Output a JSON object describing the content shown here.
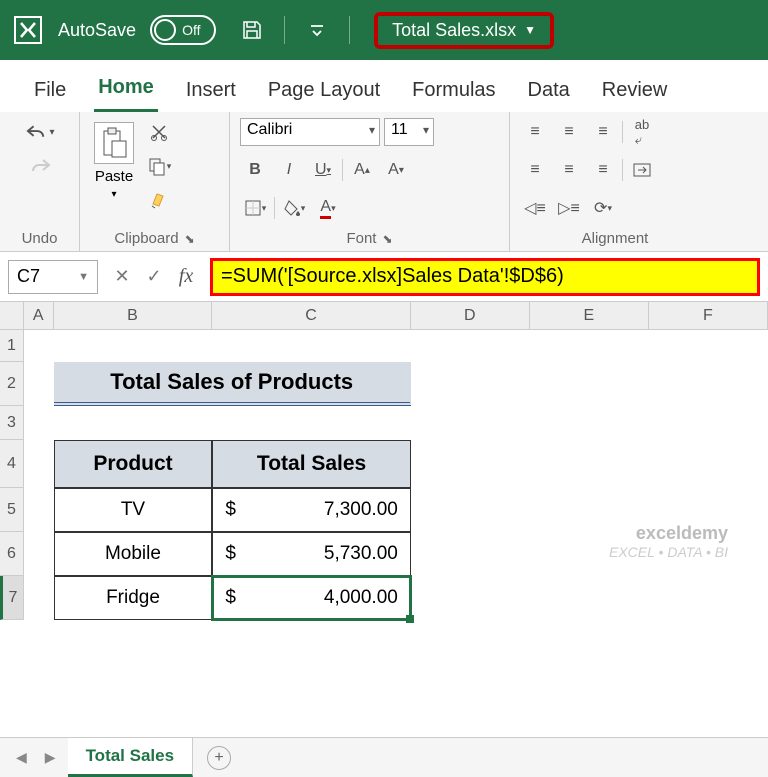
{
  "titlebar": {
    "autosave_label": "AutoSave",
    "autosave_state": "Off",
    "filename": "Total Sales.xlsx"
  },
  "tabs": {
    "file": "File",
    "home": "Home",
    "insert": "Insert",
    "page_layout": "Page Layout",
    "formulas": "Formulas",
    "data": "Data",
    "review": "Review"
  },
  "ribbon": {
    "undo": "Undo",
    "paste": "Paste",
    "clipboard": "Clipboard",
    "font_name": "Calibri",
    "font_size": "11",
    "font": "Font",
    "alignment": "Alignment"
  },
  "formula_bar": {
    "cell_ref": "C7",
    "formula": "=SUM('[Source.xlsx]Sales Data'!$D$6)"
  },
  "sheet": {
    "title": "Total Sales of Products",
    "headers": {
      "product": "Product",
      "total_sales": "Total Sales"
    },
    "rows": [
      {
        "product": "TV",
        "currency": "$",
        "value": "7,300.00"
      },
      {
        "product": "Mobile",
        "currency": "$",
        "value": "5,730.00"
      },
      {
        "product": "Fridge",
        "currency": "$",
        "value": "4,000.00"
      }
    ],
    "cols": [
      "A",
      "B",
      "C",
      "D",
      "E",
      "F"
    ],
    "rownums": [
      "1",
      "2",
      "3",
      "4",
      "5",
      "6",
      "7"
    ]
  },
  "sheet_tab": "Total Sales",
  "watermark": {
    "brand": "exceldemy",
    "tagline": "EXCEL • DATA • BI"
  }
}
